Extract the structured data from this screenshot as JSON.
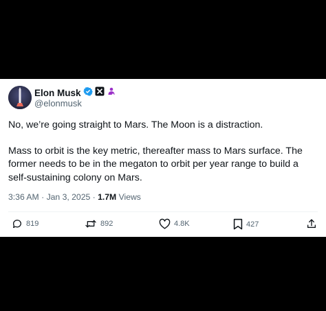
{
  "tweet": {
    "author_name": "Elon Musk",
    "handle": "@elonmusk",
    "paragraphs": [
      "No, we’re going straight to Mars. The Moon is a distraction.",
      "Mass to orbit is the key metric, thereafter mass to Mars surface. The former needs to be in the megaton to orbit per year range to build a self-sustaining colony on Mars."
    ],
    "time": "3:36 AM",
    "date": "Jan 3, 2025",
    "separator": "·",
    "views_count": "1.7M",
    "views_label": "Views"
  },
  "actions": {
    "reply_count": "819",
    "retweet_count": "892",
    "like_count": "4.8K",
    "bookmark_count": "427"
  },
  "icons": {
    "verified": "verified-badge-icon",
    "x_badge": "x-logo-icon",
    "affiliation": "person-badge-icon",
    "reply": "reply-icon",
    "retweet": "retweet-icon",
    "like": "heart-icon",
    "bookmark": "bookmark-icon",
    "share": "share-icon"
  },
  "colors": {
    "verified_blue": "#1d9bf0",
    "affiliation_purple": "#9b30c8",
    "text_primary": "#0f1419",
    "text_secondary": "#536471"
  }
}
